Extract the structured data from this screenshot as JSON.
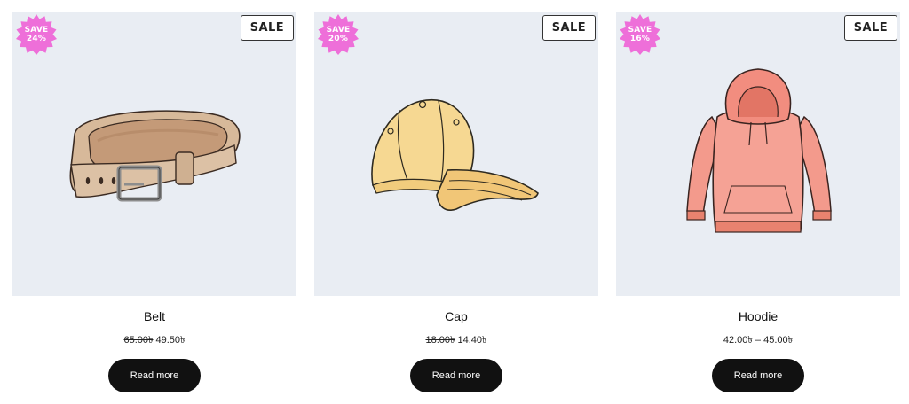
{
  "products": [
    {
      "name": "Belt",
      "save_badge": "SAVE\n24%",
      "sale_label": "SALE",
      "old_price": "65.00৳",
      "price": "49.50৳",
      "button_label": "Read more",
      "image_icon": "belt-illustration"
    },
    {
      "name": "Cap",
      "save_badge": "SAVE\n20%",
      "sale_label": "SALE",
      "old_price": "18.00৳",
      "price": "14.40৳",
      "button_label": "Read more",
      "image_icon": "cap-illustration"
    },
    {
      "name": "Hoodie",
      "save_badge": "SAVE\n16%",
      "sale_label": "SALE",
      "price_range": "42.00৳ – 45.00৳",
      "button_label": "Read more",
      "image_icon": "hoodie-illustration"
    }
  ],
  "colors": {
    "image_bg": "#e9edf3",
    "save_badge": "#ee6fd9",
    "button_bg": "#111111"
  }
}
